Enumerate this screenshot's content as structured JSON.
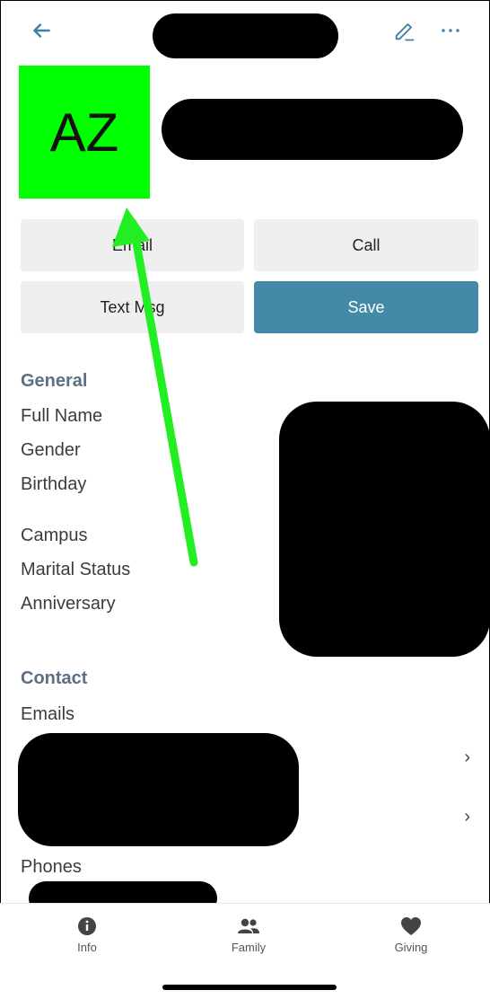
{
  "header": {
    "back_icon": "arrow-left-icon",
    "edit_icon": "pencil-icon",
    "more_icon": "ellipsis-icon"
  },
  "avatar": {
    "initials": "AZ",
    "color": "#00ff00"
  },
  "actions": {
    "email": "Email",
    "call": "Call",
    "text": "Text Msg",
    "save": "Save"
  },
  "general": {
    "title": "General",
    "fields": [
      "Full Name",
      "Gender",
      "Birthday",
      "Campus",
      "Marital Status",
      "Anniversary"
    ]
  },
  "contact": {
    "title": "Contact",
    "emails": "Emails",
    "phones": "Phones"
  },
  "tabs": [
    {
      "label": "Info",
      "icon": "info-icon"
    },
    {
      "label": "Family",
      "icon": "people-icon"
    },
    {
      "label": "Giving",
      "icon": "heart-icon"
    }
  ],
  "colors": {
    "accent": "#4589a8",
    "section": "#5c6f85",
    "annotation_arrow": "#22ee22"
  }
}
